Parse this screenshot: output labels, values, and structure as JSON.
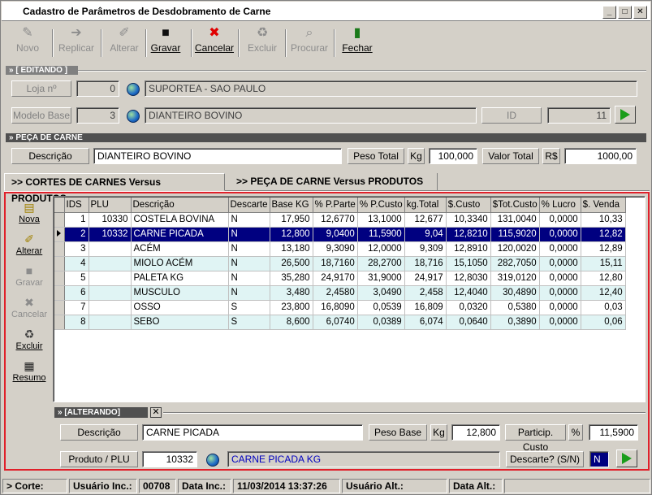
{
  "window": {
    "title": "Cadastro de Parâmetros de Desdobramento de Carne"
  },
  "toolbar": {
    "novo": "Novo",
    "replicar": "Replicar",
    "alterar": "Alterar",
    "gravar": "Gravar",
    "cancelar": "Cancelar",
    "excluir": "Excluir",
    "procurar": "Procurar",
    "fechar": "Fechar"
  },
  "edit_section": {
    "header": "» [ EDITANDO ]",
    "loja_label": "Loja nº",
    "loja_value": "0",
    "loja_name": "SUPORTEA - SAO PAULO",
    "modelo_label": "Modelo Base",
    "modelo_value": "3",
    "modelo_name": "DIANTEIRO BOVINO",
    "id_label": "ID",
    "id_value": "11"
  },
  "peca_section": {
    "header": "» PEÇA DE CARNE",
    "descricao_label": "Descrição",
    "descricao_value": "DIANTEIRO BOVINO",
    "peso_label": "Peso Total",
    "peso_unit": "Kg",
    "peso_value": "100,000",
    "valor_label": "Valor Total",
    "valor_unit": "R$",
    "valor_value": "1000,00"
  },
  "tabs": [
    ">> CORTES DE CARNES Versus PRODUTOS",
    ">> PEÇA DE CARNE Versus PRODUTOS"
  ],
  "side": {
    "nova": "Nova",
    "alterar": "Alterar",
    "gravar": "Gravar",
    "cancelar": "Cancelar",
    "excluir": "Excluir",
    "resumo": "Resumo"
  },
  "grid": {
    "columns": [
      "IDS",
      "PLU",
      "Descrição",
      "Descarte",
      "Base KG",
      "% P.Parte",
      "% P.Custo",
      "kg.Total",
      "$.Custo",
      "$Tot.Custo",
      "% Lucro",
      "$. Venda"
    ],
    "rows": [
      [
        "1",
        "10330",
        "COSTELA BOVINA",
        "N",
        "17,950",
        "12,6770",
        "13,1000",
        "12,677",
        "10,3340",
        "131,0040",
        "0,0000",
        "10,33"
      ],
      [
        "2",
        "10332",
        "CARNE PICADA",
        "N",
        "12,800",
        "9,0400",
        "11,5900",
        "9,04",
        "12,8210",
        "115,9020",
        "0,0000",
        "12,82"
      ],
      [
        "3",
        "",
        "ACÉM",
        "N",
        "13,180",
        "9,3090",
        "12,0000",
        "9,309",
        "12,8910",
        "120,0020",
        "0,0000",
        "12,89"
      ],
      [
        "4",
        "",
        "MIOLO ACÉM",
        "N",
        "26,500",
        "18,7160",
        "28,2700",
        "18,716",
        "15,1050",
        "282,7050",
        "0,0000",
        "15,11"
      ],
      [
        "5",
        "",
        "PALETA KG",
        "N",
        "35,280",
        "24,9170",
        "31,9000",
        "24,917",
        "12,8030",
        "319,0120",
        "0,0000",
        "12,80"
      ],
      [
        "6",
        "",
        "MUSCULO",
        "N",
        "3,480",
        "2,4580",
        "3,0490",
        "2,458",
        "12,4040",
        "30,4890",
        "0,0000",
        "12,40"
      ],
      [
        "7",
        "",
        "OSSO",
        "S",
        "23,800",
        "16,8090",
        "0,0539",
        "16,809",
        "0,0320",
        "0,5380",
        "0,0000",
        "0,03"
      ],
      [
        "8",
        "",
        "SEBO",
        "S",
        "8,600",
        "6,0740",
        "0,0389",
        "6,074",
        "0,0640",
        "0,3890",
        "0,0000",
        "0,06"
      ]
    ],
    "selected_index": 1
  },
  "alterando": {
    "header": "» [ALTERANDO]",
    "close": "✕",
    "descricao_label": "Descrição",
    "descricao_value": "CARNE PICADA",
    "peso_label": "Peso Base",
    "peso_unit": "Kg",
    "peso_value": "12,800",
    "particip_label": "Particip. Custo",
    "particip_unit": "%",
    "particip_value": "11,5900",
    "produto_label": "Produto / PLU",
    "produto_value": "10332",
    "produto_name": "CARNE PICADA KG",
    "descarte_label": "Descarte? (S/N)",
    "descarte_value": "N"
  },
  "status": {
    "corte": "> Corte:",
    "usuario_inc_label": "Usuário Inc.:",
    "usuario_inc_value": "00708",
    "data_inc_label": "Data Inc.:",
    "data_inc_value": "11/03/2014 13:37:26",
    "usuario_alt_label": "Usuário Alt.:",
    "data_alt_label": "Data Alt.:"
  }
}
